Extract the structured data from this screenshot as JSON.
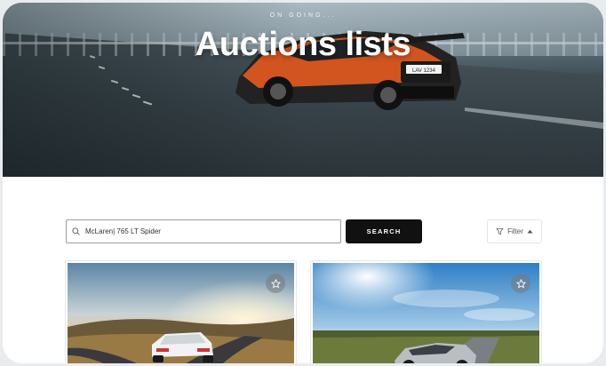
{
  "hero": {
    "kicker": "ON GOING...",
    "title": "Auctions lists",
    "plate": "LAV 1234"
  },
  "search": {
    "value": "McLaren| 765 LT Spider",
    "button_label": "SEARCH"
  },
  "filter": {
    "label": "Filter"
  },
  "colors": {
    "button_dark": "#111111",
    "car_orange": "#d2541f"
  },
  "cards": [
    {
      "image": "sunset-road-white-sports-car",
      "icon": "star-icon"
    },
    {
      "image": "sunny-field-silver-coupe",
      "icon": "star-icon"
    }
  ]
}
